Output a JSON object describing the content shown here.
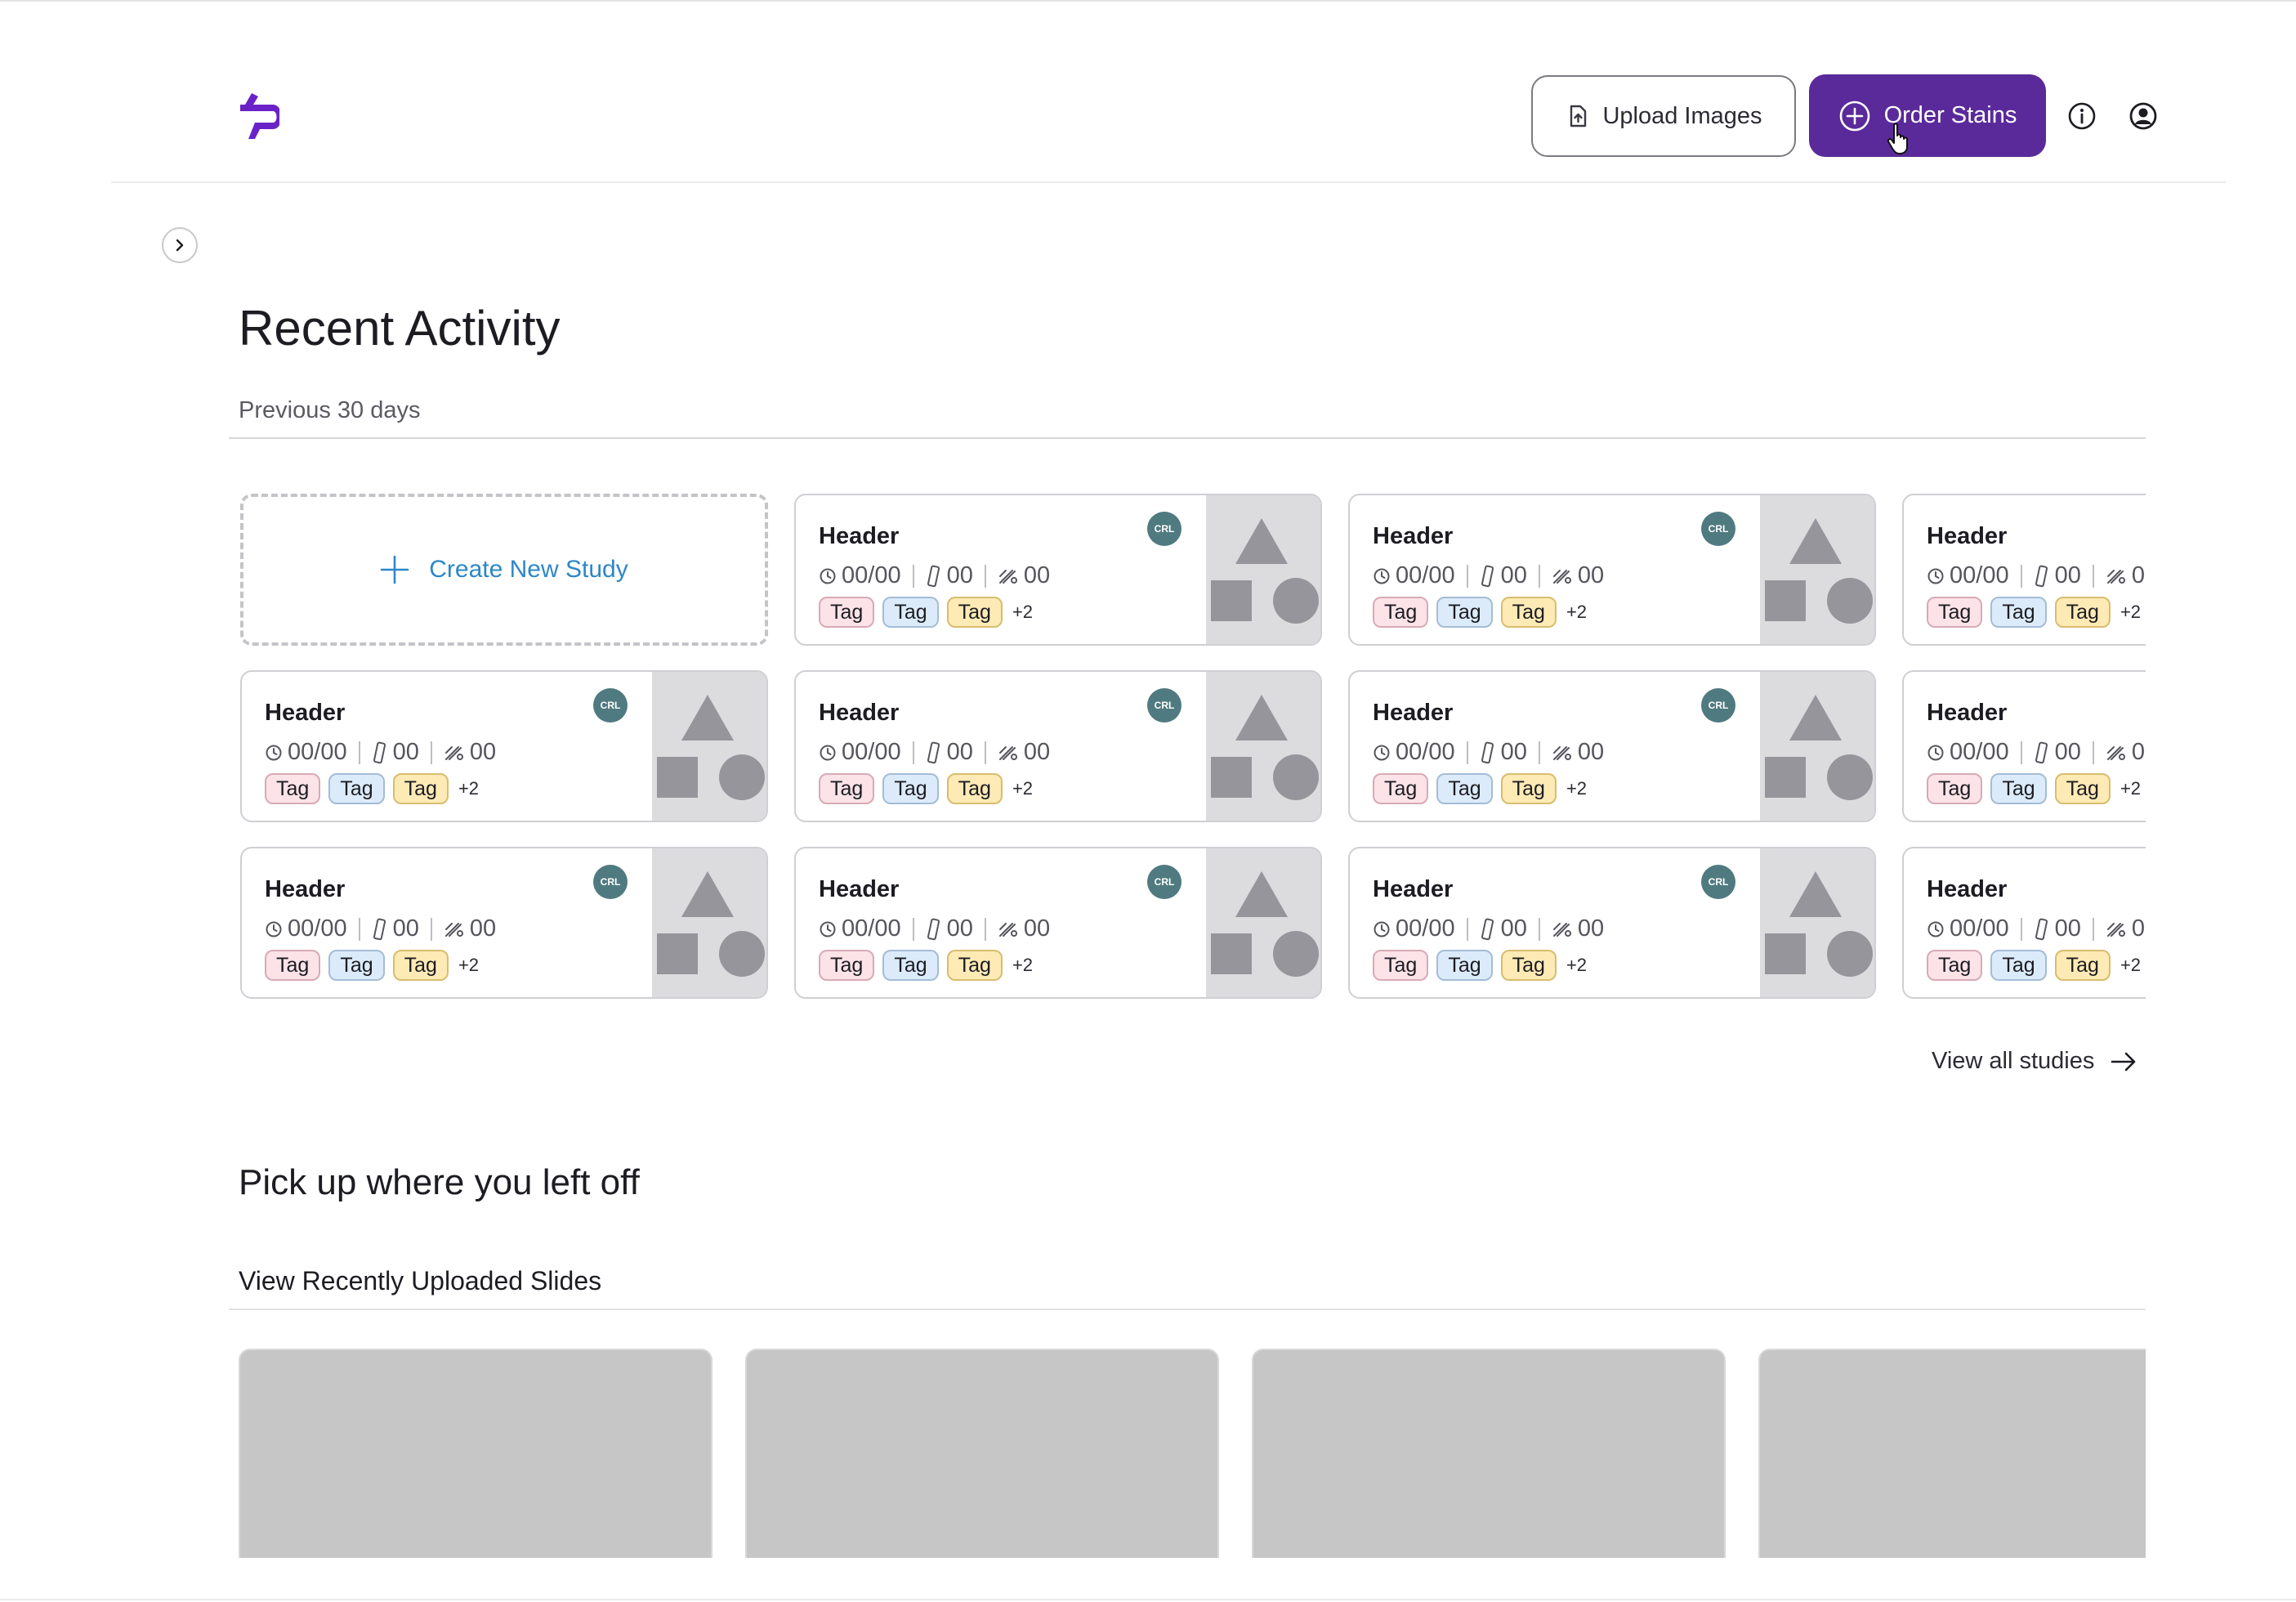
{
  "header": {
    "upload_label": "Upload Images",
    "order_label": "Order Stains",
    "accent_color": "#5a2a9a",
    "logo_color": "#6a22c8"
  },
  "recent": {
    "title": "Recent Activity",
    "subtitle": "Previous 30 days",
    "create_label": "Create New Study",
    "view_all_label": "View all studies"
  },
  "card": {
    "title": "Header",
    "avatar": "CRL",
    "date": "00/00",
    "slides_count": "00",
    "stains_count": "00",
    "tags": [
      "Tag",
      "Tag",
      "Tag"
    ],
    "more": "+2"
  },
  "pickup": {
    "title": "Pick up where you left off",
    "slides_title": "View Recently Uploaded Slides"
  }
}
